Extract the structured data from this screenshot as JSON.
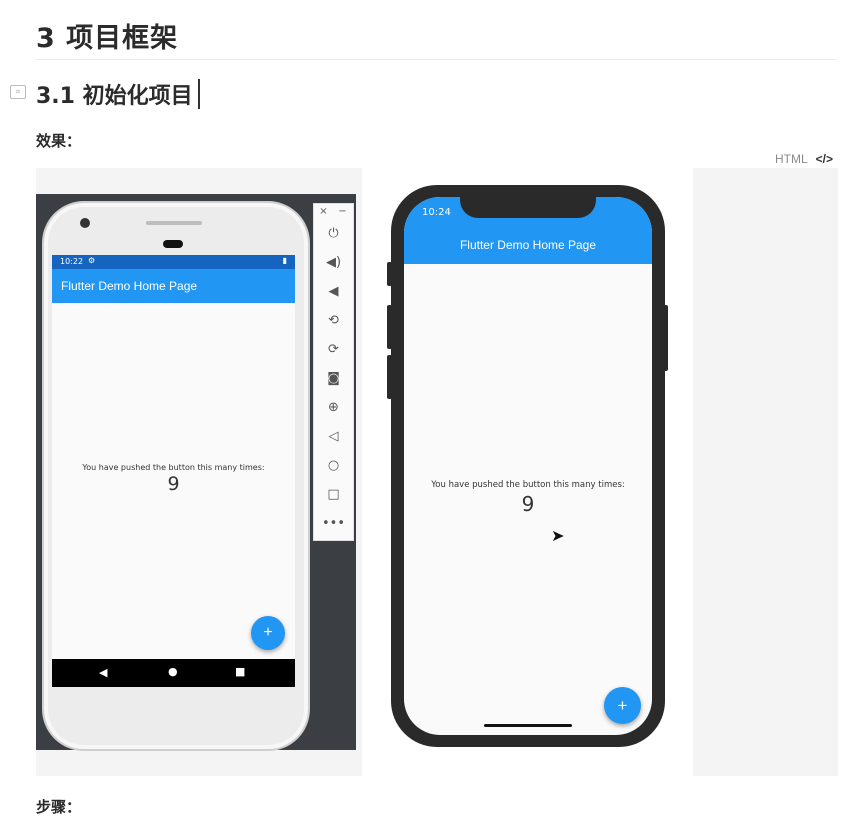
{
  "heading": "3 项目框架",
  "subheading": "3.1 初始化项目",
  "effect_label": "效果：",
  "steps_label": "步骤：",
  "html_toolbar": {
    "label": "HTML",
    "code_icon": "</>"
  },
  "android": {
    "status_time": "10:22",
    "title": "Flutter Demo Home Page",
    "message": "You have pushed the button this many times:",
    "count": "9",
    "fab": "+",
    "toolbar_icons": [
      "×",
      "−",
      "⏻",
      "🔊",
      "🔉",
      "⟳",
      "⟲",
      "📷",
      "🔍",
      "◁",
      "○",
      "□",
      "•••"
    ]
  },
  "iphone": {
    "status_time": "10:24",
    "title": "Flutter Demo Home Page",
    "message": "You have pushed the button this many times:",
    "count": "9",
    "fab": "+"
  },
  "colors": {
    "appbar": "#2196f3",
    "status": "#1565c0"
  }
}
